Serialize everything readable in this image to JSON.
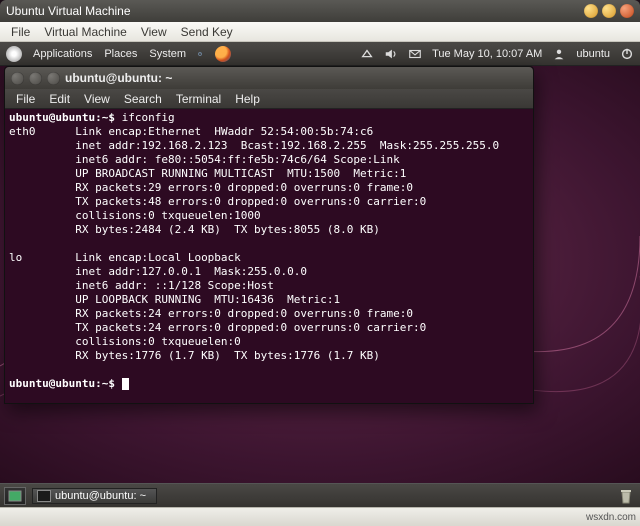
{
  "vm": {
    "title": "Ubuntu Virtual Machine",
    "menu": {
      "file": "File",
      "machine": "Virtual Machine",
      "view": "View",
      "sendkey": "Send Key"
    }
  },
  "panel": {
    "applications": "Applications",
    "places": "Places",
    "system": "System",
    "clock": "Tue May 10, 10:07 AM",
    "user": "ubuntu"
  },
  "terminal": {
    "title": "ubuntu@ubuntu: ~",
    "menu": {
      "file": "File",
      "edit": "Edit",
      "view": "View",
      "search": "Search",
      "terminal": "Terminal",
      "help": "Help"
    },
    "prompt1": "ubuntu@ubuntu:~$ ",
    "cmd1": "ifconfig",
    "eth0_label": "eth0",
    "eth0": [
      "Link encap:Ethernet  HWaddr 52:54:00:5b:74:c6",
      "inet addr:192.168.2.123  Bcast:192.168.2.255  Mask:255.255.255.0",
      "inet6 addr: fe80::5054:ff:fe5b:74c6/64 Scope:Link",
      "UP BROADCAST RUNNING MULTICAST  MTU:1500  Metric:1",
      "RX packets:29 errors:0 dropped:0 overruns:0 frame:0",
      "TX packets:48 errors:0 dropped:0 overruns:0 carrier:0",
      "collisions:0 txqueuelen:1000",
      "RX bytes:2484 (2.4 KB)  TX bytes:8055 (8.0 KB)"
    ],
    "lo_label": "lo",
    "lo": [
      "Link encap:Local Loopback",
      "inet addr:127.0.0.1  Mask:255.0.0.0",
      "inet6 addr: ::1/128 Scope:Host",
      "UP LOOPBACK RUNNING  MTU:16436  Metric:1",
      "RX packets:24 errors:0 dropped:0 overruns:0 frame:0",
      "TX packets:24 errors:0 dropped:0 overruns:0 carrier:0",
      "collisions:0 txqueuelen:0",
      "RX bytes:1776 (1.7 KB)  TX bytes:1776 (1.7 KB)"
    ],
    "prompt2": "ubuntu@ubuntu:~$ "
  },
  "taskbar": {
    "task1": "ubuntu@ubuntu: ~"
  },
  "watermark": "wsxdn.com"
}
